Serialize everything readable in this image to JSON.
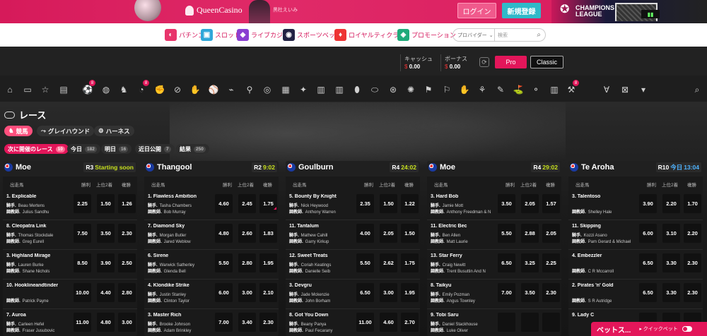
{
  "topbar": {
    "brand": "QueenCasino",
    "mascot_caption": "黒杜えいみ",
    "login_label": "ログイン",
    "register_label": "新規登録",
    "promo_title": "CHAMPIONS",
    "promo_subtitle": "LEAGUE"
  },
  "nav": {
    "items": [
      {
        "label": "パチンコ",
        "icon": "pachinko-icon",
        "color": "#e8356b"
      },
      {
        "label": "スロット",
        "icon": "slot-icon",
        "color": "#2fa7d9"
      },
      {
        "label": "ライブカジノ",
        "icon": "live-casino-icon",
        "color": "#8a3fd1"
      },
      {
        "label": "スポーツベット",
        "icon": "sports-bet-icon",
        "color": "#222244"
      },
      {
        "label": "ロイヤルティクラブ",
        "icon": "royalty-club-icon",
        "color": "#e33"
      },
      {
        "label": "プロモーション",
        "icon": "promotion-icon",
        "color": "#1faa7a"
      }
    ],
    "provider_label": "プロバイダー",
    "search_placeholder": "検索"
  },
  "wallet": {
    "cash_label": "キャッシュ",
    "cash_currency": "$",
    "cash_amount": "0.00",
    "bonus_label": "ボーナス",
    "bonus_currency": "$",
    "bonus_amount": "0.00",
    "pro_label": "Pro",
    "classic_label": "Classic"
  },
  "race": {
    "title": "レース",
    "chips": [
      {
        "label": "競馬",
        "active": true
      },
      {
        "label": "グレイハウンド",
        "active": false
      },
      {
        "label": "ハーネス",
        "active": false
      }
    ],
    "filters": [
      {
        "label": "次に開催のレース",
        "count": "10",
        "active": true
      },
      {
        "label": "今日",
        "count": "182",
        "active": false
      },
      {
        "label": "明日",
        "count": "16",
        "active": false
      },
      {
        "label": "近日公開",
        "count": "7",
        "active": false
      },
      {
        "label": "結果",
        "count": "250",
        "active": false
      }
    ],
    "col_horse": "出走馬",
    "col_win": "勝利",
    "col_top2": "上位2着",
    "col_place": "複勝",
    "jockey_prefix": "騎手.",
    "trainer_prefix": "調教師."
  },
  "cards": [
    {
      "venue": "Moe",
      "round": "R3",
      "time": "Starting soon",
      "time_color": "green",
      "runners": [
        {
          "name": "1. Explicable",
          "jockey": "Beau Mertens",
          "trainer": "Julius Sandhu",
          "odds": [
            "2.25",
            "1.50",
            "1.26"
          ]
        },
        {
          "name": "8. Cleopatra Link",
          "jockey": "Thomas Stockdale",
          "trainer": "Greg Eurell",
          "odds": [
            "7.50",
            "3.50",
            "2.30"
          ]
        },
        {
          "name": "3. Highland Mirage",
          "jockey": "Lauren Burke",
          "trainer": "Shane Nichols",
          "odds": [
            "8.50",
            "3.90",
            "2.50"
          ]
        },
        {
          "name": "10. Hooklineandtinder",
          "jockey": "",
          "trainer": "Patrick Payne",
          "odds": [
            "10.00",
            "4.40",
            "2.80"
          ]
        },
        {
          "name": "7. Auroa",
          "jockey": "Carleen Hefel",
          "trainer": "Fraser Jusubovic",
          "odds": [
            "11.00",
            "4.80",
            "3.00"
          ]
        }
      ]
    },
    {
      "venue": "Thangool",
      "round": "R2",
      "time": "9:02",
      "time_color": "green",
      "runners": [
        {
          "name": "1. Flawless Ambition",
          "jockey": "Tasha Chambers",
          "trainer": "Bob Murray",
          "odds": [
            "4.60",
            "2.45",
            "1.75"
          ]
        },
        {
          "name": "7. Diamond Sky",
          "jockey": "Morgan Butler",
          "trainer": "Jared Weblow",
          "odds": [
            "4.80",
            "2.60",
            "1.83"
          ]
        },
        {
          "name": "6. Sirene",
          "jockey": "Warwick Satherley",
          "trainer": "Glenda Bell",
          "odds": [
            "5.50",
            "2.80",
            "1.95"
          ]
        },
        {
          "name": "4. Klondike Strike",
          "jockey": "Justin Stanley",
          "trainer": "Clinton Taylor",
          "odds": [
            "6.00",
            "3.00",
            "2.10"
          ]
        },
        {
          "name": "3. Master Rich",
          "jockey": "Brooke Johnson",
          "trainer": "Adam Brinkley",
          "odds": [
            "7.00",
            "3.40",
            "2.30"
          ]
        }
      ]
    },
    {
      "venue": "Goulburn",
      "round": "R4",
      "time": "24:02",
      "time_color": "green",
      "runners": [
        {
          "name": "5. Bounty By Knight",
          "jockey": "Nick Heywood",
          "trainer": "Anthony Warren",
          "odds": [
            "2.35",
            "1.50",
            "1.22"
          ]
        },
        {
          "name": "11. Tantalum",
          "jockey": "Mathew Cahill",
          "trainer": "Garry Kirkup",
          "odds": [
            "4.00",
            "2.05",
            "1.50"
          ]
        },
        {
          "name": "12. Sweet Treats",
          "jockey": "Coriah Keatings",
          "trainer": "Danielle Seib",
          "odds": [
            "5.50",
            "2.62",
            "1.75"
          ]
        },
        {
          "name": "3. Devgru",
          "jockey": "Jade Mckenzie",
          "trainer": "John Borham",
          "odds": [
            "6.50",
            "3.00",
            "1.95"
          ]
        },
        {
          "name": "8. Got You Down",
          "jockey": "Beany Panya",
          "trainer": "Paul Fecarany",
          "odds": [
            "11.00",
            "4.60",
            "2.70"
          ]
        }
      ]
    },
    {
      "venue": "Moe",
      "round": "R4",
      "time": "29:02",
      "time_color": "green",
      "runners": [
        {
          "name": "3. Hard Bob",
          "jockey": "Jamie Mott",
          "trainer": "Anthony Freedman & N",
          "odds": [
            "3.50",
            "2.05",
            "1.57"
          ]
        },
        {
          "name": "11. Electric Bec",
          "jockey": "Ben Allen",
          "trainer": "Matt Laurie",
          "odds": [
            "5.50",
            "2.88",
            "2.05"
          ]
        },
        {
          "name": "13. Star Ferry",
          "jockey": "Craig Newitt",
          "trainer": "Trent Busuttin And N",
          "odds": [
            "6.50",
            "3.25",
            "2.25"
          ]
        },
        {
          "name": "8. Taikyu",
          "jockey": "Emily Pozman",
          "trainer": "Angus Townley",
          "odds": [
            "7.00",
            "3.50",
            "2.30"
          ]
        },
        {
          "name": "9. Tobi Saru",
          "jockey": "Daniel Stackhouse",
          "trainer": "Luke Oliver",
          "odds": [
            "",
            "",
            ""
          ]
        }
      ]
    },
    {
      "venue": "Te Aroha",
      "round": "R10",
      "time_prefix": "今日",
      "time": "13:04",
      "time_color": "blue",
      "runners": [
        {
          "name": "3. Talentoso",
          "jockey": "",
          "trainer": "Shelley Hale",
          "odds": [
            "3.90",
            "2.20",
            "1.70"
          ]
        },
        {
          "name": "11. Skipping",
          "jockey": "Kozzi Asano",
          "trainer": "Pam Gerard & Michael",
          "odds": [
            "6.00",
            "3.10",
            "2.20"
          ]
        },
        {
          "name": "4. Embezzler",
          "jockey": "",
          "trainer": "C R Mccarroll",
          "odds": [
            "6.50",
            "3.30",
            "2.30"
          ]
        },
        {
          "name": "2. Pirates 'n' Gold",
          "jockey": "",
          "trainer": "S R Autridge",
          "odds": [
            "6.50",
            "3.30",
            "2.30"
          ]
        },
        {
          "name": "9. Lady C",
          "jockey": "",
          "trainer": "",
          "odds": [
            "",
            "",
            ""
          ]
        }
      ]
    }
  ],
  "betslip": {
    "label": "ベットス...",
    "quick_bet": "▸ クイックベット"
  }
}
